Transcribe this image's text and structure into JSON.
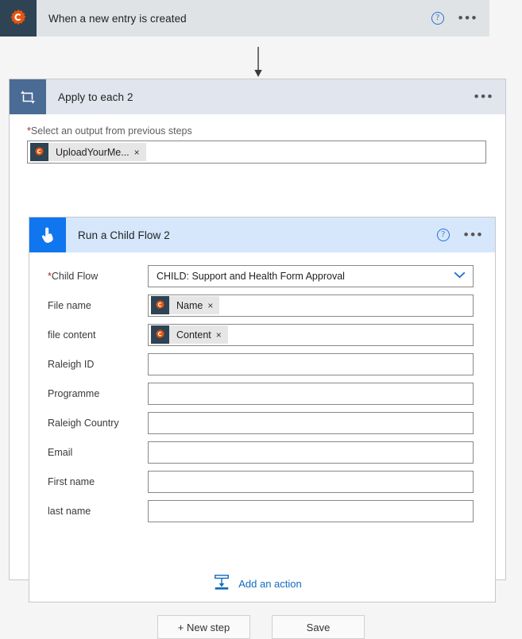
{
  "trigger": {
    "title": "When a new entry is created",
    "icon": "cognito-forms-gear-icon",
    "help_label": "?",
    "more_label": "•••"
  },
  "loop": {
    "title": "Apply to each 2",
    "icon": "loop-icon",
    "more_label": "•••",
    "output_field": {
      "required_marker": "*",
      "label": "Select an output from previous steps",
      "token": {
        "text": "UploadYourMe...",
        "remove_label": "×",
        "icon": "cognito-forms-gear-icon"
      }
    }
  },
  "child_flow": {
    "title": "Run a Child Flow 2",
    "icon": "tap-hand-icon",
    "help_label": "?",
    "more_label": "•••",
    "dropdown": {
      "required_marker": "*",
      "label": "Child Flow",
      "value": "CHILD: Support and Health Form Approval",
      "chevron": "⌄"
    },
    "fields": [
      {
        "label": "File name",
        "value": "",
        "token": {
          "text": "Name",
          "remove_label": "×",
          "icon": "cognito-forms-gear-icon"
        }
      },
      {
        "label": "file content",
        "value": "",
        "token": {
          "text": "Content",
          "remove_label": "×",
          "icon": "cognito-forms-gear-icon"
        }
      },
      {
        "label": "Raleigh ID",
        "value": "",
        "token": null
      },
      {
        "label": "Programme",
        "value": "",
        "token": null
      },
      {
        "label": "Raleigh Country",
        "value": "",
        "token": null
      },
      {
        "label": "Email",
        "value": "",
        "token": null
      },
      {
        "label": "First name",
        "value": "",
        "token": null
      },
      {
        "label": "last name",
        "value": "",
        "token": null
      }
    ]
  },
  "add_action": {
    "label": "Add an action",
    "icon": "insert-step-icon"
  },
  "footer": {
    "new_step_label": "+ New step",
    "save_label": "Save"
  },
  "colors": {
    "accent_blue": "#0f6cbd",
    "trigger_header": "#dfe3e6",
    "loop_header": "#e1e5ee",
    "child_header": "#d6e7fb",
    "cognito_icon_bg": "#2e4353",
    "cognito_orange": "#e8540e",
    "loop_icon_bg": "#4a6b94",
    "flow_icon_bg": "#0f76ef",
    "required_red": "#a4262c",
    "page_bg": "#f5f5f5"
  }
}
